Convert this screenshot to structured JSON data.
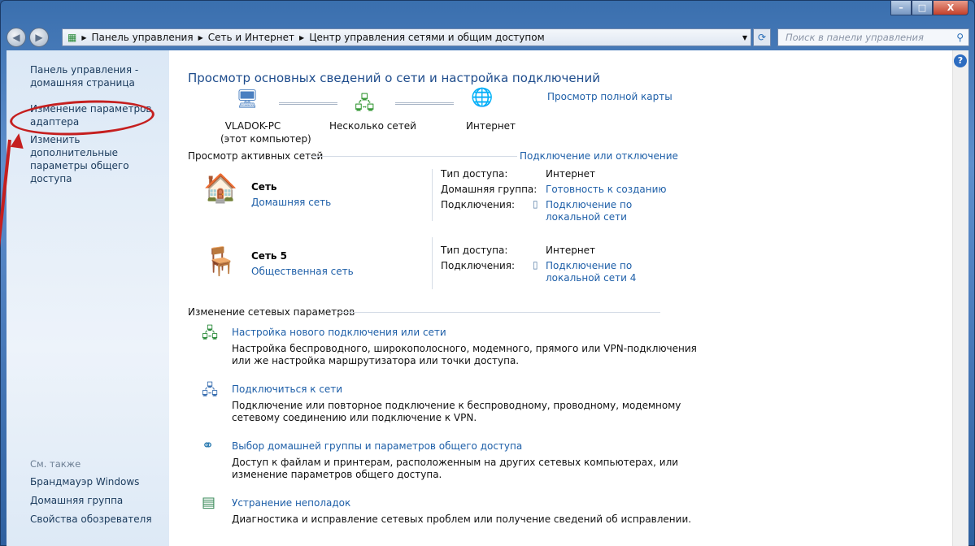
{
  "window": {
    "min": "–",
    "max": "□",
    "close": "X"
  },
  "nav": {
    "back": "◀",
    "forward": "▶",
    "breadcrumb": [
      "Панель управления",
      "Сеть и Интернет",
      "Центр управления сетями и общим доступом"
    ],
    "search_placeholder": "Поиск в панели управления"
  },
  "sidebar": {
    "home": [
      "Панель управления -",
      "домашняя страница"
    ],
    "adapter": [
      "Изменение параметров",
      "адаптера"
    ],
    "sharing": [
      "Изменить дополнительные",
      "параметры общего доступа"
    ],
    "see_also": "См. также",
    "also_links": [
      "Брандмауэр Windows",
      "Домашняя группа",
      "Свойства обозревателя"
    ]
  },
  "main": {
    "title": "Просмотр основных сведений о сети и настройка подключений",
    "full_map": "Просмотр полной карты",
    "map": {
      "pc": "VLADOK-PC",
      "pc_sub": "(этот компьютер)",
      "networks": "Несколько сетей",
      "internet": "Интернет"
    },
    "active_header": "Просмотр активных сетей",
    "connect_disconnect": "Подключение или отключение",
    "networks": [
      {
        "name": "Сеть",
        "type": "Домашняя сеть",
        "access_label": "Тип доступа:",
        "access": "Интернет",
        "homegroup_label": "Домашняя группа:",
        "homegroup": "Готовность к созданию",
        "conn_label": "Подключения:",
        "conn": [
          "Подключение по",
          "локальной сети"
        ]
      },
      {
        "name": "Сеть  5",
        "type": "Общественная сеть",
        "access_label": "Тип доступа:",
        "access": "Интернет",
        "conn_label": "Подключения:",
        "conn": [
          "Подключение по",
          "локальной сети 4"
        ]
      }
    ],
    "change_header": "Изменение сетевых параметров",
    "tasks": [
      {
        "title": "Настройка нового подключения или сети",
        "desc": [
          "Настройка беспроводного, широкополосного, модемного, прямого или VPN-подключения",
          "или же настройка маршрутизатора или точки доступа."
        ]
      },
      {
        "title": "Подключиться к сети",
        "desc": [
          "Подключение или повторное подключение к беспроводному, проводному, модемному",
          "сетевому соединению или подключение к VPN."
        ]
      },
      {
        "title": "Выбор домашней группы и параметров общего доступа",
        "desc": [
          "Доступ к файлам и принтерам, расположенным на других сетевых компьютерах, или",
          "изменение параметров общего доступа."
        ]
      },
      {
        "title": "Устранение неполадок",
        "desc": [
          "Диагностика и исправление сетевых проблем или получение сведений об исправлении."
        ]
      }
    ]
  }
}
